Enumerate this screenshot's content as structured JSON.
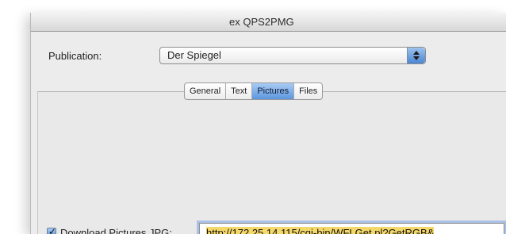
{
  "window": {
    "title": "ex QPS2PMG"
  },
  "publication": {
    "label": "Publication:",
    "selected": "Der Spiegel"
  },
  "tabs": [
    {
      "label": "General",
      "active": false
    },
    {
      "label": "Text",
      "active": false
    },
    {
      "label": "Pictures",
      "active": true
    },
    {
      "label": "Files",
      "active": false
    }
  ],
  "download": {
    "checkbox_label": "Download Pictures JPG:",
    "checked": true,
    "url_value": "http://172.25.14.115/cgi-bin/WFLGet.pl?GetRGB&"
  },
  "icons": {
    "select_arrows": "up-down-chevron-icon",
    "checkbox": "checkmark-icon"
  },
  "colors": {
    "active_tab": "#5c96de",
    "selection_highlight": "#f5d86a"
  }
}
